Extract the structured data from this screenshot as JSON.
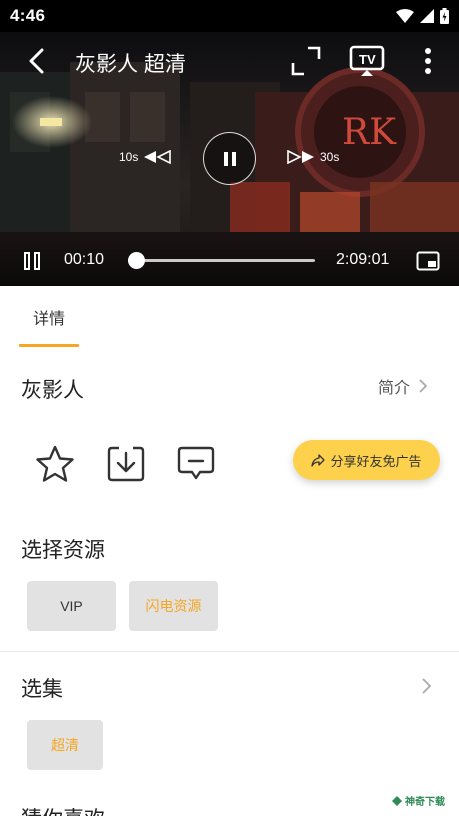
{
  "status_bar": {
    "time": "4:46"
  },
  "player": {
    "title": "灰影人 超清",
    "rewind_label": "10s",
    "forward_label": "30s",
    "current_time": "00:10",
    "total_time": "2:09:01",
    "progress": 0.0013,
    "scene_sign": "RK"
  },
  "tabs": [
    {
      "label": "详情",
      "active": true
    }
  ],
  "details": {
    "movie_title": "灰影人",
    "intro_label": "简介",
    "share_label": "分享好友免广告"
  },
  "sources": {
    "title": "选择资源",
    "items": [
      {
        "label": "VIP",
        "selected": false
      },
      {
        "label": "闪电资源",
        "selected": true
      }
    ]
  },
  "episodes": {
    "title": "选集",
    "items": [
      {
        "label": "超清",
        "selected": true
      }
    ]
  },
  "guess": {
    "title": "猜你喜欢"
  },
  "watermark": "神奇下载",
  "colors": {
    "accent": "#f5a623",
    "share_bg": "#fdd14c"
  }
}
